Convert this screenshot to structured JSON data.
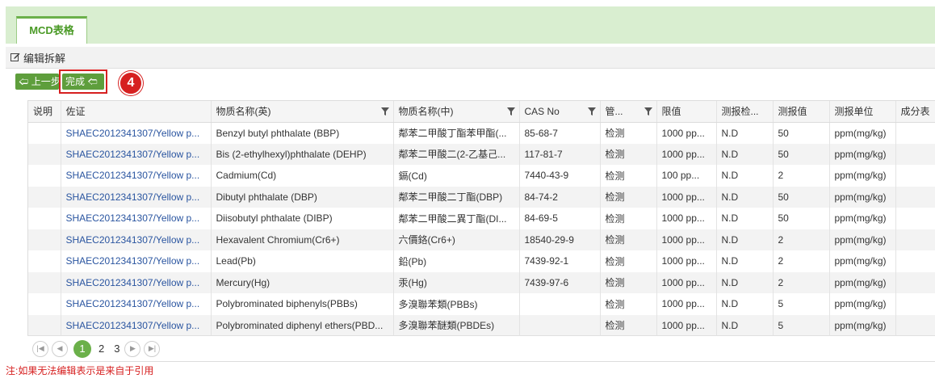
{
  "tab": {
    "label": "MCD表格"
  },
  "toolbar": {
    "title": "编辑拆解"
  },
  "buttons": {
    "prev": "上一步",
    "done": "完成"
  },
  "step_badge": "4",
  "table": {
    "headers": [
      "说明",
      "佐证",
      "物质名称(英)",
      "物质名称(中)",
      "CAS No",
      "管...",
      "限值",
      "测报检...",
      "测报值",
      "测报单位",
      "成分表"
    ],
    "rows": [
      [
        "",
        "SHAEC2012341307/Yellow p...",
        "Benzyl butyl phthalate (BBP)",
        "鄰苯二甲酸丁酯苯甲酯(...",
        "85-68-7",
        "检测",
        "1000 pp...",
        "N.D",
        "50",
        "ppm(mg/kg)",
        ""
      ],
      [
        "",
        "SHAEC2012341307/Yellow p...",
        "Bis (2-ethylhexyl)phthalate (DEHP)",
        "鄰苯二甲酸二(2-乙基己...",
        "117-81-7",
        "检测",
        "1000 pp...",
        "N.D",
        "50",
        "ppm(mg/kg)",
        ""
      ],
      [
        "",
        "SHAEC2012341307/Yellow p...",
        "Cadmium(Cd)",
        "鎘(Cd)",
        "7440-43-9",
        "检测",
        "100 pp...",
        "N.D",
        "2",
        "ppm(mg/kg)",
        ""
      ],
      [
        "",
        "SHAEC2012341307/Yellow p...",
        "Dibutyl phthalate (DBP)",
        "鄰苯二甲酸二丁酯(DBP)",
        "84-74-2",
        "检测",
        "1000 pp...",
        "N.D",
        "50",
        "ppm(mg/kg)",
        ""
      ],
      [
        "",
        "SHAEC2012341307/Yellow p...",
        "Diisobutyl phthalate (DIBP)",
        "鄰苯二甲酸二異丁酯(DI...",
        "84-69-5",
        "检测",
        "1000 pp...",
        "N.D",
        "50",
        "ppm(mg/kg)",
        ""
      ],
      [
        "",
        "SHAEC2012341307/Yellow p...",
        "Hexavalent Chromium(Cr6+)",
        "六價鉻(Cr6+)",
        "18540-29-9",
        "检测",
        "1000 pp...",
        "N.D",
        "2",
        "ppm(mg/kg)",
        ""
      ],
      [
        "",
        "SHAEC2012341307/Yellow p...",
        "Lead(Pb)",
        "鉛(Pb)",
        "7439-92-1",
        "检测",
        "1000 pp...",
        "N.D",
        "2",
        "ppm(mg/kg)",
        ""
      ],
      [
        "",
        "SHAEC2012341307/Yellow p...",
        "Mercury(Hg)",
        "汞(Hg)",
        "7439-97-6",
        "检测",
        "1000 pp...",
        "N.D",
        "2",
        "ppm(mg/kg)",
        ""
      ],
      [
        "",
        "SHAEC2012341307/Yellow p...",
        "Polybrominated biphenyls(PBBs)",
        "多溴聯苯類(PBBs)",
        "",
        "检测",
        "1000 pp...",
        "N.D",
        "5",
        "ppm(mg/kg)",
        ""
      ],
      [
        "",
        "SHAEC2012341307/Yellow p...",
        "Polybrominated diphenyl ethers(PBD...",
        "多溴聯苯醚類(PBDEs)",
        "",
        "检测",
        "1000 pp...",
        "N.D",
        "5",
        "ppm(mg/kg)",
        ""
      ]
    ]
  },
  "pager": {
    "pages": [
      "1",
      "2",
      "3"
    ],
    "current": "1"
  },
  "note": "注:如果无法编辑表示是来自于引用",
  "colors": {
    "accent": "#6bb04a",
    "button": "#5e9e3c",
    "highlight": "#d62020",
    "link": "#2a55a0",
    "band": "#d9eed0"
  }
}
